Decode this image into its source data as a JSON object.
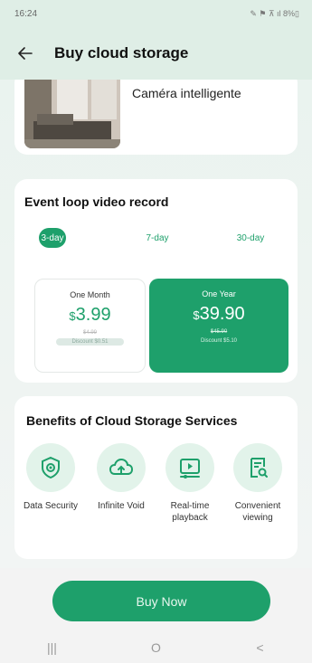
{
  "status_bar": {
    "time": "16:24",
    "icons_text": "✎ ⚑ ⊼ ıl 8%▯"
  },
  "header": {
    "back_icon": "arrow-left-icon",
    "title": "Buy cloud storage"
  },
  "camera": {
    "name": "Caméra intelligente"
  },
  "event_record": {
    "title": "Event loop video record",
    "tabs": [
      {
        "label": "3-day",
        "active": true
      },
      {
        "label": "7-day",
        "active": false
      },
      {
        "label": "30-day",
        "active": false
      }
    ],
    "plans": [
      {
        "name": "One Month",
        "currency": "$",
        "price": "3.99",
        "old_price": "$4.99",
        "discount": "Discount $0.51",
        "selected": false
      },
      {
        "name": "One Year",
        "currency": "$",
        "price": "39.90",
        "old_price": "$45.90",
        "discount": "Discount $5.10",
        "selected": true
      }
    ]
  },
  "benefits": {
    "title": "Benefits of Cloud Storage Services",
    "items": [
      {
        "label": "Data Security",
        "icon": "shield-eye-icon"
      },
      {
        "label": "Infinite Void",
        "icon": "cloud-upload-icon"
      },
      {
        "label": "Real-time playback",
        "icon": "video-play-icon"
      },
      {
        "label": "Convenient viewing",
        "icon": "document-search-icon"
      }
    ]
  },
  "buy_button": {
    "label": "Buy Now"
  },
  "nav": {
    "recents": "|||",
    "home": "O",
    "back": "<"
  },
  "colors": {
    "accent": "#1ea06b",
    "accent_light": "#e2f3ea",
    "background": "#eaf3ef"
  }
}
